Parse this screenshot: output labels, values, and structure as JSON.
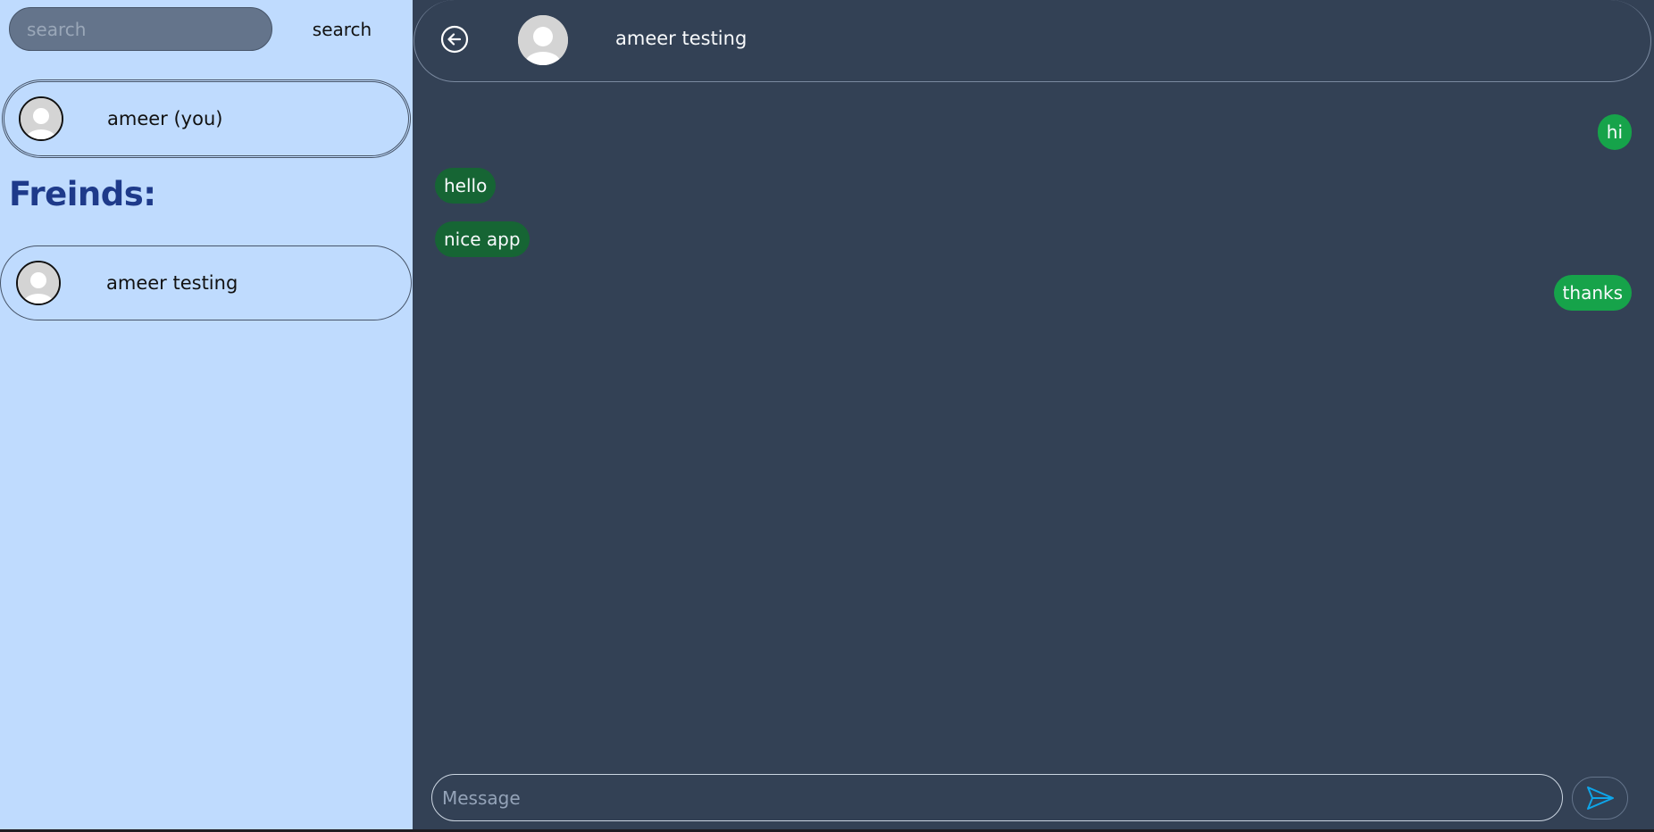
{
  "sidebar": {
    "search": {
      "placeholder": "search",
      "value": "",
      "button_label": "search"
    },
    "me": {
      "name": "ameer (you)"
    },
    "friends_heading": "Freinds:",
    "friends": [
      {
        "name": "ameer testing"
      }
    ]
  },
  "chat": {
    "header": {
      "name": "ameer testing"
    },
    "messages": [
      {
        "text": "hi",
        "direction": "sent"
      },
      {
        "text": "hello",
        "direction": "received"
      },
      {
        "text": "nice app",
        "direction": "received"
      },
      {
        "text": "thanks",
        "direction": "sent"
      }
    ],
    "composer": {
      "placeholder": "Message",
      "value": ""
    }
  },
  "colors": {
    "sidebar_bg": "#bfdbfe",
    "chat_bg": "#334155",
    "sent_bubble": "#16a34a",
    "received_bubble": "#166534",
    "heading": "#1e3a8a",
    "send_icon": "#0ea5e9"
  },
  "icons": {
    "back": "arrow-left-circle-icon",
    "avatar": "user-avatar-icon",
    "send": "paper-plane-icon"
  }
}
